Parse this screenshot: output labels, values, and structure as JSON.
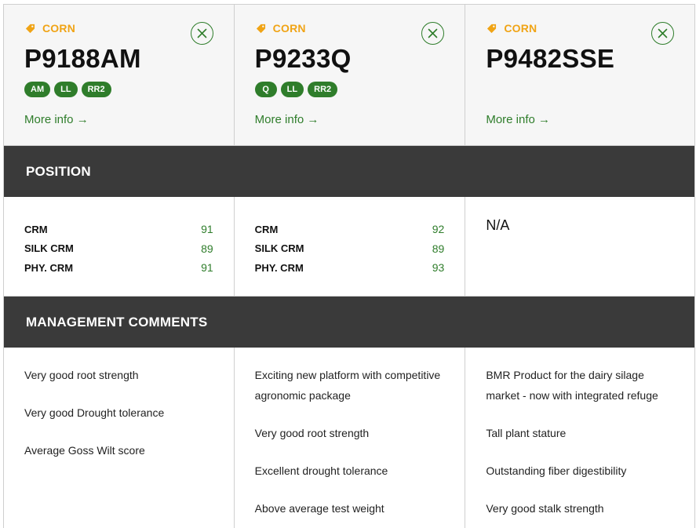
{
  "products": [
    {
      "crop": "CORN",
      "name": "P9188AM",
      "badges": [
        "AM",
        "LL",
        "RR2"
      ],
      "more_info": "More info →",
      "position": [
        {
          "label": "CRM",
          "value": "91"
        },
        {
          "label": "SILK CRM",
          "value": "89"
        },
        {
          "label": "PHY. CRM",
          "value": "91"
        }
      ],
      "comments": [
        "Very good root strength",
        "Very good Drought tolerance",
        "Average Goss Wilt score"
      ]
    },
    {
      "crop": "CORN",
      "name": "P9233Q",
      "badges": [
        "Q",
        "LL",
        "RR2"
      ],
      "more_info": "More info →",
      "position": [
        {
          "label": "CRM",
          "value": "92"
        },
        {
          "label": "SILK CRM",
          "value": "89"
        },
        {
          "label": "PHY. CRM",
          "value": "93"
        }
      ],
      "comments": [
        "Exciting new platform with competitive agronomic package",
        "Very good root strength",
        "Excellent drought tolerance",
        "Above average test weight"
      ]
    },
    {
      "crop": "CORN",
      "name": "P9482SSE",
      "badges": [],
      "more_info": "More info →",
      "position_na": "N/A",
      "comments": [
        "BMR Product for the dairy silage market - now with integrated refuge",
        "Tall plant stature",
        "Outstanding fiber digestibility",
        "Very good stalk strength"
      ]
    }
  ],
  "sections": {
    "position": "POSITION",
    "management": "MANAGEMENT COMMENTS"
  },
  "colors": {
    "accent_green": "#2f7d2b",
    "crop_orange": "#f0a416",
    "section_bar": "#3a3a3a"
  }
}
